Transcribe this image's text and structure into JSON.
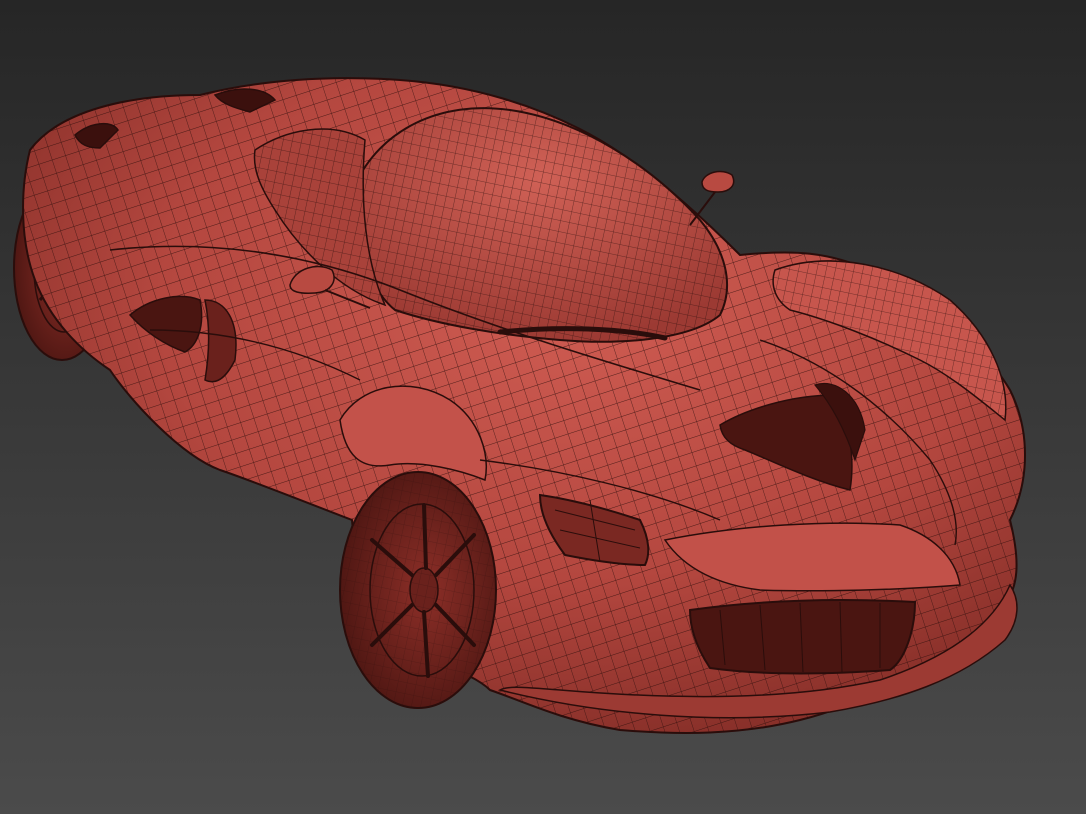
{
  "scene": {
    "subject": "sports-car-wireframe-model",
    "colors": {
      "background_top": "#2a2a2a",
      "background_bottom": "#4a4a4a",
      "body_base": "#b4473f",
      "body_light": "#cf5c52",
      "body_shadow": "#6a211c",
      "wire": "#2a0d0b",
      "cavity": "#3b100d"
    }
  }
}
